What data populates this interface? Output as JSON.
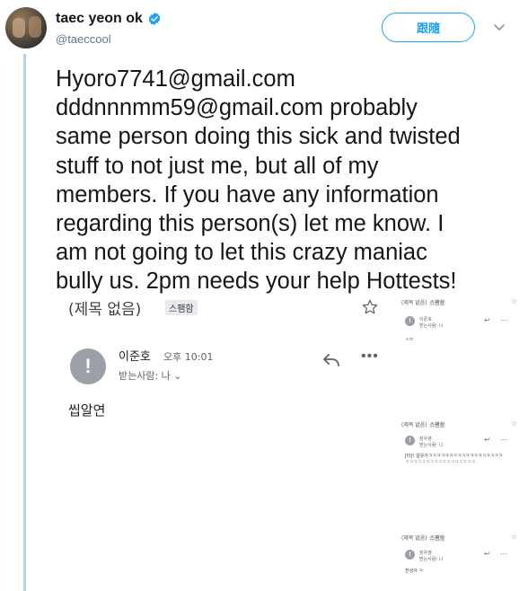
{
  "tweet": {
    "author_name": "taec yeon ok",
    "author_handle": "@taeccool",
    "follow_label": "跟隨",
    "text": "Hyoro7741@gmail.com\ndddnnnmm59@gmail.com probably\nsame person doing this sick and twisted\nstuff to not just me, but all of my\nmembers. If you have any information\nregarding this person(s) let me know. I\nam not going to let this crazy maniac\nbully us. 2pm needs your help Hottests!"
  },
  "email": {
    "subject": "(제목 없음)",
    "spam_tag": "스팸함",
    "sender_name": "이준호",
    "time": "오후 10:01",
    "recipient": "받는사람: 나 ⌄",
    "body": "씹알연"
  },
  "mini_emails": [
    {
      "subject": "(제목 없음)",
      "tag": "스팸함",
      "sender": "이준호",
      "recipient": "받는사람: 나",
      "body": "ㅅㅂ"
    },
    {
      "subject": "(제목 없음)",
      "tag": "스팸함",
      "sender": "장우영",
      "recipient": "받는사람: 나",
      "body": "[타]! 알유가ㅋㅋㅋㅋㅋㅋㅋㅋㅋㅋㅋㅋㅋㅋㅋㅋㅋㅋ",
      "body2": "ㅋㅋㅋㅋㅋㅋㅋㅋㅋㅋㅋㅋㅋㅋㅋㅋㅋ"
    },
    {
      "subject": "(제목 없음)",
      "tag": "스팸함",
      "sender": "장우영",
      "recipient": "받는사람: 나",
      "body": "찬성아 ㅋ"
    }
  ],
  "colors": {
    "accent": "#1da1f2",
    "thread_line": "#b7d4ea",
    "warning_gray": "#9aa0a6"
  },
  "icons": [
    "verified-badge-icon",
    "chevron-down-icon",
    "star-icon",
    "reply-icon",
    "more-options-icon",
    "warning-icon"
  ]
}
